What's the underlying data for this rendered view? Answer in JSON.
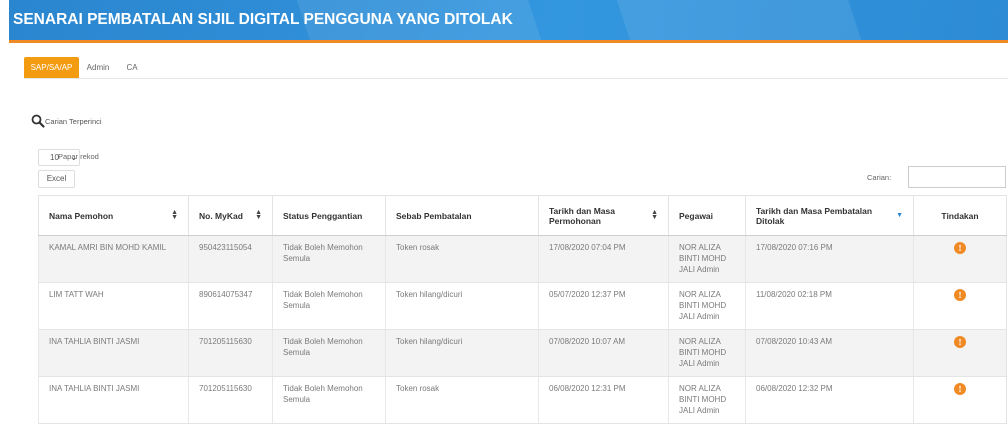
{
  "header": {
    "title": "SENARAI PEMBATALAN SIJIL DIGITAL PENGGUNA YANG DITOLAK",
    "bg_color": "#2f8fd8",
    "accent_line_color": "#f08a24"
  },
  "tabs": [
    {
      "label": "SAP/SA/AP",
      "active": true
    },
    {
      "label": "Admin",
      "active": false
    },
    {
      "label": "CA",
      "active": false
    }
  ],
  "advanced_search": {
    "label": "Carian Terperinci",
    "icon": "search-icon"
  },
  "page_length": {
    "value": "10",
    "label": "Papar rekod"
  },
  "export": {
    "excel_label": "Excel"
  },
  "filter": {
    "label": "Carian:",
    "value": ""
  },
  "table": {
    "columns": [
      "Nama Pemohon",
      "No. MyKad",
      "Status Penggantian",
      "Sebab Pembatalan",
      "Tarikh dan Masa Permohonan",
      "Pegawai",
      "Tarikh dan Masa Pembatalan Ditolak",
      "Tindakan"
    ],
    "rows": [
      {
        "nama": "KAMAL AMRI BIN MOHD KAMIL",
        "mykad": "950423115054",
        "status": "Tidak Boleh Memohon Semula",
        "sebab": "Token rosak",
        "tarikh_permohonan": "17/08/2020 07:04 PM",
        "pegawai": "NOR ALIZA BINTI MOHD JALI Admin",
        "tarikh_ditolak": "17/08/2020 07:16 PM"
      },
      {
        "nama": "LIM TATT WAH",
        "mykad": "890614075347",
        "status": "Tidak Boleh Memohon Semula",
        "sebab": "Token hilang/dicuri",
        "tarikh_permohonan": "05/07/2020 12:37 PM",
        "pegawai": "NOR ALIZA BINTI MOHD JALI Admin",
        "tarikh_ditolak": "11/08/2020 02:18 PM"
      },
      {
        "nama": "INA TAHLIA BINTI JASMI",
        "mykad": "701205115630",
        "status": "Tidak Boleh Memohon Semula",
        "sebab": "Token hilang/dicuri",
        "tarikh_permohonan": "07/08/2020 10:07 AM",
        "pegawai": "NOR ALIZA BINTI MOHD JALI Admin",
        "tarikh_ditolak": "07/08/2020 10:43 AM"
      },
      {
        "nama": "INA TAHLIA BINTI JASMI",
        "mykad": "701205115630",
        "status": "Tidak Boleh Memohon Semula",
        "sebab": "Token rosak",
        "tarikh_permohonan": "06/08/2020 12:31 PM",
        "pegawai": "NOR ALIZA BINTI MOHD JALI Admin",
        "tarikh_ditolak": "06/08/2020 12:32 PM"
      }
    ],
    "action_icon": "info-icon",
    "action_glyph": "!",
    "action_color": "#f08a24"
  }
}
